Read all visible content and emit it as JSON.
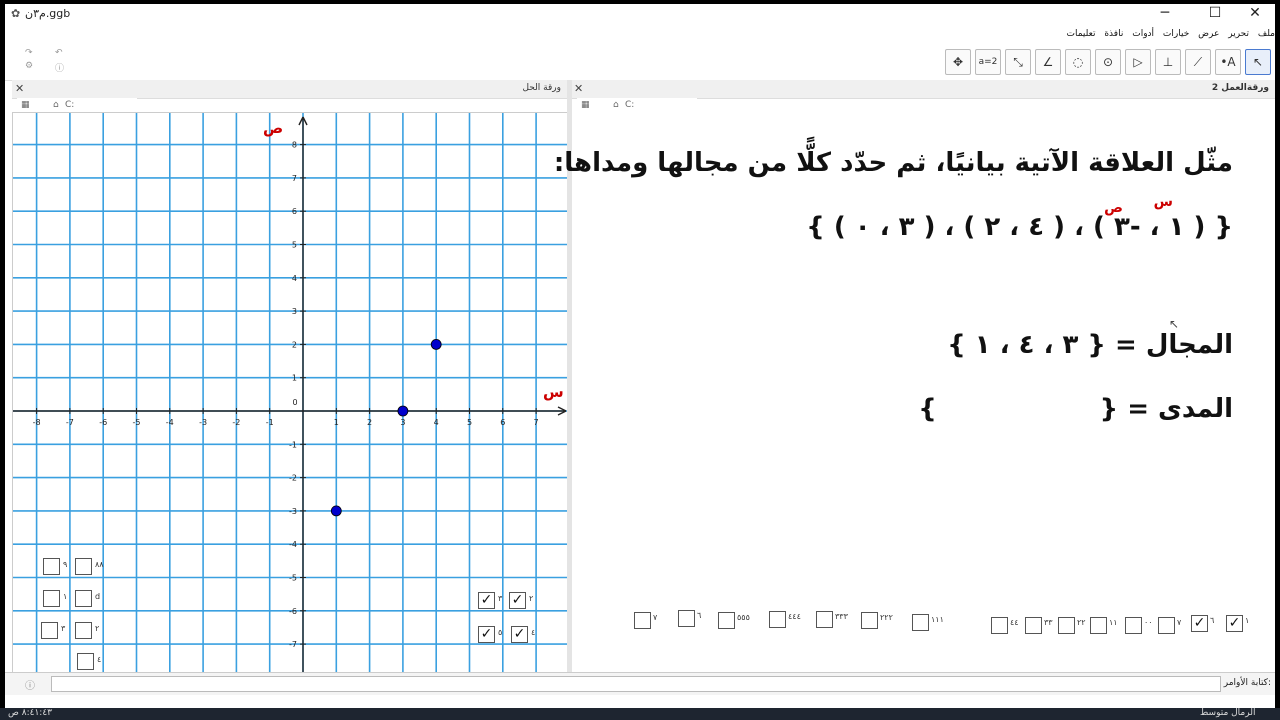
{
  "window": {
    "title": "م٣ن.ggb",
    "minimize": "─",
    "maximize": "☐",
    "close": "✕"
  },
  "menu": [
    "ملف",
    "تحرير",
    "عرض",
    "خيارات",
    "أدوات",
    "نافذة",
    "تعليمات"
  ],
  "toolbar": {
    "tools": [
      {
        "name": "move",
        "glyph": "↖"
      },
      {
        "name": "point",
        "glyph": "•A"
      },
      {
        "name": "line",
        "glyph": "⟋"
      },
      {
        "name": "perpendicular",
        "glyph": "⊥"
      },
      {
        "name": "polygon",
        "glyph": "▷"
      },
      {
        "name": "circle",
        "glyph": "⊙"
      },
      {
        "name": "ellipse",
        "glyph": "◌"
      },
      {
        "name": "angle",
        "glyph": "∠"
      },
      {
        "name": "reflect",
        "glyph": "⤡"
      },
      {
        "name": "slider",
        "glyph": "a=2"
      },
      {
        "name": "move-graphics",
        "glyph": "✥"
      }
    ]
  },
  "panels": {
    "graphics_title": "ورقة الحل",
    "worksheet_title": "ورقةالعمل 2",
    "coord_label": "C:"
  },
  "graph": {
    "x_label": "س",
    "y_label": "ص",
    "x_ticks": [
      "-8",
      "-7",
      "-6",
      "-5",
      "-4",
      "-3",
      "-2",
      "-1",
      "0",
      "1",
      "2",
      "3",
      "4",
      "5",
      "6",
      "7"
    ],
    "y_ticks": [
      "8",
      "7",
      "6",
      "5",
      "4",
      "3",
      "2",
      "1",
      "0",
      "-1",
      "-2",
      "-3",
      "-4",
      "-5",
      "-6",
      "-7"
    ],
    "points": [
      {
        "x": 4,
        "y": 2
      },
      {
        "x": 3,
        "y": 0
      },
      {
        "x": 1,
        "y": -3
      }
    ],
    "point_color": "#0000cc",
    "grid_color": "#3aa0e0"
  },
  "graph_checkboxes": {
    "labels": [
      "٩",
      "٨٨",
      "١",
      "d",
      "٣",
      "٢",
      "٤",
      "٣",
      "٢",
      "٥",
      "٤"
    ]
  },
  "worksheet": {
    "line1": "مثّل العلاقة الآتية بيانيًا، ثم حدّد كلًّا من مجالها ومداها:",
    "set": "{ ( ٣ ، ٠ ) ، ( ٤ ، ٢ ) ، ( ١ ، -٣ ) }",
    "s_label": "س",
    "p_label": "ص",
    "domain_line": "المجال = { ٣ ، ٤ ، ١ }",
    "range_line": "المدى = {                  }"
  },
  "worksheet_checkboxes": {
    "labels": [
      "٧",
      "٦",
      "٥٥٥",
      "٤٤٤",
      "٣٣٣",
      "٢٢٢",
      "١١١",
      "٤٤",
      "٣٣",
      "٢٢",
      "١١",
      "٠٠",
      "٧",
      "٦",
      "١"
    ]
  },
  "inputbar": {
    "label": "كتابة الأوامر:"
  },
  "taskbar": {
    "time": "٨:٤١:٤٣ ص",
    "weather": "الرمال متوسط"
  }
}
